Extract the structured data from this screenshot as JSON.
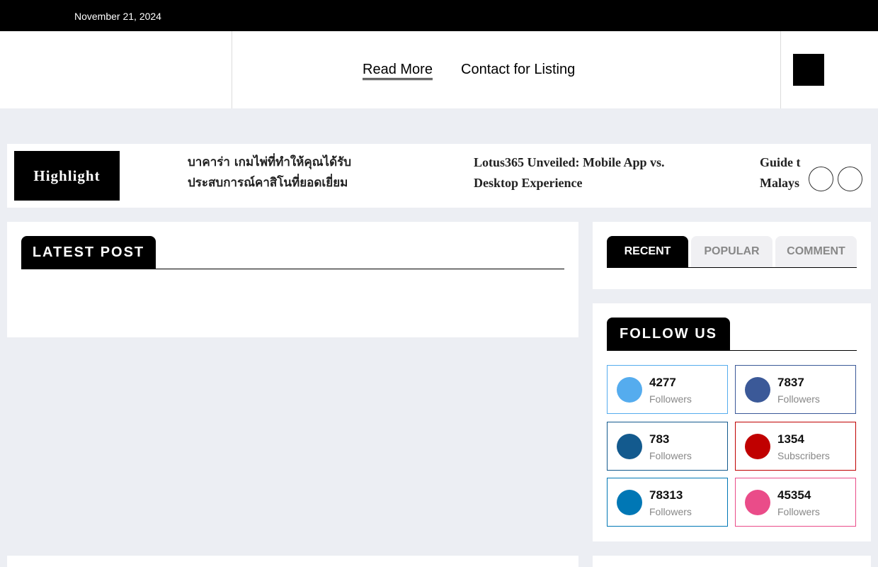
{
  "topbar": {
    "date": "November 21, 2024"
  },
  "nav": {
    "items": [
      {
        "label": "Read More"
      },
      {
        "label": "Contact for Listing"
      }
    ]
  },
  "ticker": {
    "label": "Highlight",
    "items": [
      {
        "line1": "บาคาร่า เกมไพ่ที่ทำให้คุณได้รับ",
        "line2": "ประสบการณ์คาสิโนที่ยอดเยี่ยม"
      },
      {
        "line1": "Lotus365 Unveiled: Mobile App vs.",
        "line2": "Desktop Experience"
      },
      {
        "line1": "Guide t",
        "line2": "Malays"
      }
    ]
  },
  "latest": {
    "title": "LATEST POST"
  },
  "tabs": {
    "items": [
      {
        "label": "RECENT"
      },
      {
        "label": "POPULAR"
      },
      {
        "label": "COMMENT"
      }
    ]
  },
  "follow": {
    "title": "FOLLOW US",
    "socials": [
      {
        "icon": "twitter-icon",
        "count": "4277",
        "unit": "Followers",
        "color": "#55acee",
        "border": "#55acee"
      },
      {
        "icon": "facebook-icon",
        "count": "7837",
        "unit": "Followers",
        "color": "#3b5998",
        "border": "#3b5998"
      },
      {
        "icon": "tumblr-icon",
        "count": "783",
        "unit": "Followers",
        "color": "#135a8e",
        "border": "#135a8e"
      },
      {
        "icon": "youtube-icon",
        "count": "1354",
        "unit": "Subscribers",
        "color": "#c00000",
        "border": "#c00000"
      },
      {
        "icon": "linkedin-icon",
        "count": "78313",
        "unit": "Followers",
        "color": "#0077b5",
        "border": "#0077b5"
      },
      {
        "icon": "instagram-icon",
        "count": "45354",
        "unit": "Followers",
        "color": "#ea4c89",
        "border": "#ea4c89"
      }
    ]
  }
}
